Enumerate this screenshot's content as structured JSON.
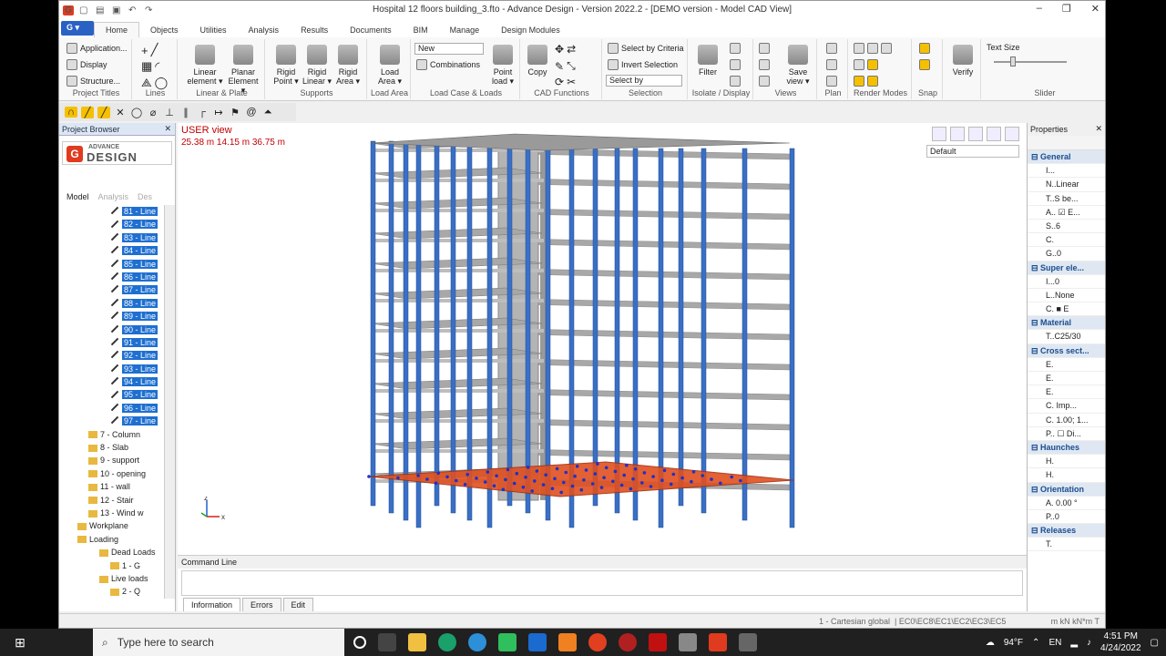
{
  "window": {
    "title": "Hospital 12 floors building_3.fto - Advance Design - Version 2022.2 - [DEMO version - Model CAD View]",
    "app_icon": "G"
  },
  "tabs": [
    "Home",
    "Objects",
    "Utilities",
    "Analysis",
    "Results",
    "Documents",
    "BIM",
    "Manage",
    "Design Modules"
  ],
  "ribbon": {
    "project_titles": {
      "label": "Project Titles",
      "items": [
        "Application...",
        "Display",
        "Structure..."
      ]
    },
    "lines": {
      "label": "Lines"
    },
    "linear_plate": {
      "label": "Linear & Plate",
      "linear": "Linear element",
      "planar": "Planar Element"
    },
    "supports": {
      "label": "Supports",
      "point": "Rigid Point",
      "linear": "Rigid Linear",
      "area": "Rigid Area"
    },
    "load_area": {
      "label": "Load Area",
      "button": "Load Area"
    },
    "load_case": {
      "label": "Load Case & Loads",
      "new": "New",
      "combinations": "Combinations",
      "point_load": "Point load"
    },
    "cad": {
      "label": "CAD Functions",
      "copy": "Copy"
    },
    "selection": {
      "label": "Selection",
      "criteria": "Select by Criteria",
      "invert": "Invert Selection",
      "select_by": "Select by"
    },
    "isolate": {
      "label": "Isolate / Display",
      "filter": "Filter"
    },
    "views": {
      "label": "Views",
      "save": "Save view"
    },
    "plan": {
      "label": "Plan"
    },
    "render": {
      "label": "Render Modes"
    },
    "snap": {
      "label": "Snap"
    },
    "verify": {
      "label": "Verify"
    },
    "slider": {
      "label": "Slider",
      "text_size": "Text Size"
    }
  },
  "project_browser": {
    "title": "Project Browser",
    "logo_small": "ADVANCE",
    "logo_big": "DESIGN",
    "logo_g": "G",
    "tabs": [
      "Model",
      "Analysis",
      "Des"
    ],
    "rows": [
      {
        "t": "81 - Line",
        "sel": true
      },
      {
        "t": "82 - Line",
        "sel": true
      },
      {
        "t": "83 - Line",
        "sel": true
      },
      {
        "t": "84 - Line",
        "sel": true
      },
      {
        "t": "85 - Line",
        "sel": true
      },
      {
        "t": "86 - Line",
        "sel": true
      },
      {
        "t": "87 - Line",
        "sel": true
      },
      {
        "t": "88 - Line",
        "sel": true
      },
      {
        "t": "89 - Line",
        "sel": true
      },
      {
        "t": "90 - Line",
        "sel": true
      },
      {
        "t": "91 - Line",
        "sel": true
      },
      {
        "t": "92 - Line",
        "sel": true
      },
      {
        "t": "93 - Line",
        "sel": true
      },
      {
        "t": "94 - Line",
        "sel": true
      },
      {
        "t": "95 - Line",
        "sel": true
      },
      {
        "t": "96 - Line",
        "sel": true
      },
      {
        "t": "97 - Line",
        "sel": true
      },
      {
        "t": "7 - Column",
        "sel": false,
        "f": 1
      },
      {
        "t": "8 - Slab",
        "sel": false,
        "f": 1
      },
      {
        "t": "9 - support",
        "sel": false,
        "f": 1
      },
      {
        "t": "10 - opening",
        "sel": false,
        "f": 1
      },
      {
        "t": "11 - wall",
        "sel": false,
        "f": 1
      },
      {
        "t": "12 - Stair",
        "sel": false,
        "f": 1
      },
      {
        "t": "13 - Wind w",
        "sel": false,
        "f": 1
      },
      {
        "t": "Workplane",
        "sel": false,
        "f": 0
      },
      {
        "t": "Loading",
        "sel": false,
        "f": 0
      },
      {
        "t": "Dead Loads",
        "sel": false,
        "f": 2
      },
      {
        "t": "1 - G",
        "sel": false,
        "f": 3
      },
      {
        "t": "Live loads",
        "sel": false,
        "f": 2
      },
      {
        "t": "2 - Q",
        "sel": false,
        "f": 3
      }
    ]
  },
  "view": {
    "title": "USER view",
    "coords": "25.38 m  14.15 m  36.75 m",
    "display_mode": "Default"
  },
  "command": {
    "title": "Command Line",
    "tabs": [
      "Information",
      "Errors",
      "Edit"
    ]
  },
  "properties": {
    "title": "Properties",
    "rows": [
      {
        "t": "General",
        "s": true
      },
      {
        "t": "I..."
      },
      {
        "t": "N..Linear"
      },
      {
        "t": "T..S be..."
      },
      {
        "t": "A.. ☑  E..."
      },
      {
        "t": "S..6"
      },
      {
        "t": "C."
      },
      {
        "t": "G..0"
      },
      {
        "t": "Super ele...",
        "s": true
      },
      {
        "t": "I...0"
      },
      {
        "t": "L..None"
      },
      {
        "t": "C. ■ E"
      },
      {
        "t": "Material",
        "s": true
      },
      {
        "t": "T..C25/30"
      },
      {
        "t": "Cross sect...",
        "s": true
      },
      {
        "t": "E."
      },
      {
        "t": "E."
      },
      {
        "t": "E."
      },
      {
        "t": "C. Imp..."
      },
      {
        "t": "C. 1.00; 1..."
      },
      {
        "t": "P.. ☐ Di..."
      },
      {
        "t": "Haunches",
        "s": true
      },
      {
        "t": "H."
      },
      {
        "t": "H."
      },
      {
        "t": "Orientation",
        "s": true
      },
      {
        "t": "A. 0.00 °"
      },
      {
        "t": "P..0"
      },
      {
        "t": "Releases",
        "s": true
      },
      {
        "t": "T."
      }
    ]
  },
  "statusbar": {
    "coord_system": "1 - Cartesian global",
    "codes": "EC0\\EC8\\EC1\\EC2\\EC3\\EC5",
    "units": "m   kN   kN*m   T"
  },
  "taskbar": {
    "search": "Type here to search",
    "weather": "94°F",
    "lang": "EN",
    "time": "4:51 PM",
    "date": "4/24/2022"
  },
  "colors": {
    "column": "#3a6fc4",
    "slab": "#a8a8a8",
    "core": "#b4b4b4",
    "load": "#e05020",
    "node": "#2030c8"
  }
}
